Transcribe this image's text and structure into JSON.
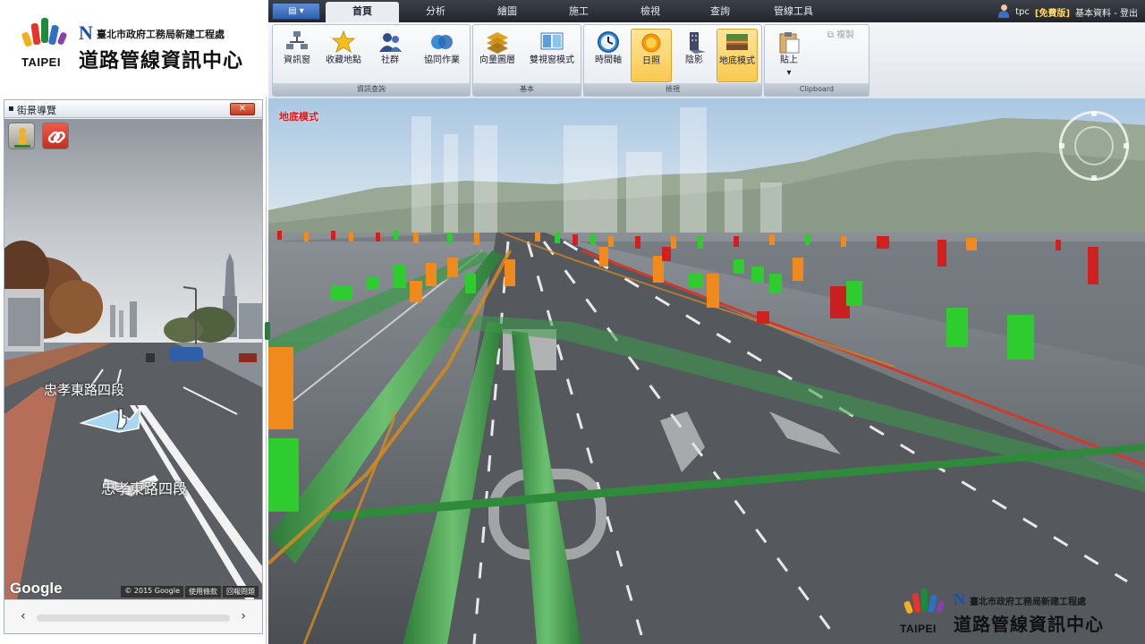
{
  "logo": {
    "taipei": "TAIPEI",
    "agency": "臺北市政府工務局新建工程處",
    "center": "道路管線資訊中心"
  },
  "street_view": {
    "title": "街景導覽",
    "close_label": "✕",
    "road_label_top": "忠孝東路四段",
    "road_label_bottom": "忠孝東路四段",
    "google": "Google",
    "footer": [
      "© 2015 Google",
      "使用條款",
      "回報問題"
    ]
  },
  "ribbon": {
    "app_menu_label": "▤ ▾",
    "tabs": [
      "首頁",
      "分析",
      "繪圖",
      "施工",
      "檢視",
      "查詢",
      "管線工具"
    ],
    "active_tab": "首頁",
    "user_name": "tpc",
    "user_level": "[免費版]",
    "user_links": "基本資料 - 登出",
    "groups": [
      {
        "label": "資訊查詢",
        "buttons": [
          {
            "label": "資訊窗",
            "icon": "info-window-icon"
          },
          {
            "label": "收藏地點",
            "icon": "star-icon"
          },
          {
            "label": "社群",
            "icon": "community-icon"
          },
          {
            "label": "協同作業",
            "icon": "collaboration-icon"
          }
        ]
      },
      {
        "label": "基本",
        "buttons": [
          {
            "label": "向量圖層",
            "icon": "layers-icon"
          },
          {
            "label": "雙視窗模式",
            "icon": "dual-window-icon"
          }
        ]
      },
      {
        "label": "檢視",
        "buttons": [
          {
            "label": "時間軸",
            "icon": "timeline-icon"
          },
          {
            "label": "日照",
            "icon": "sun-icon",
            "active": true
          },
          {
            "label": "陰影",
            "icon": "shadow-icon"
          },
          {
            "label": "地底模式",
            "icon": "underground-icon",
            "active": true
          }
        ]
      },
      {
        "label": "Clipboard",
        "buttons": [
          {
            "label": "貼上",
            "icon": "paste-icon"
          },
          {
            "label": "複製",
            "icon": "copy-icon",
            "disabled": true
          }
        ]
      }
    ]
  },
  "map": {
    "mode_label": "地底模式"
  },
  "map_logo": {
    "taipei": "TAIPEI",
    "agency": "臺北市政府工務局新建工程處",
    "center": "道路管線資訊中心"
  },
  "colors": {
    "pipe_green": "#3a9a48",
    "pipe_orange": "#d48a1e",
    "marker_green": "#2ecc2e",
    "marker_orange": "#f08a1c",
    "marker_red": "#d02020",
    "road": "#52565c"
  }
}
